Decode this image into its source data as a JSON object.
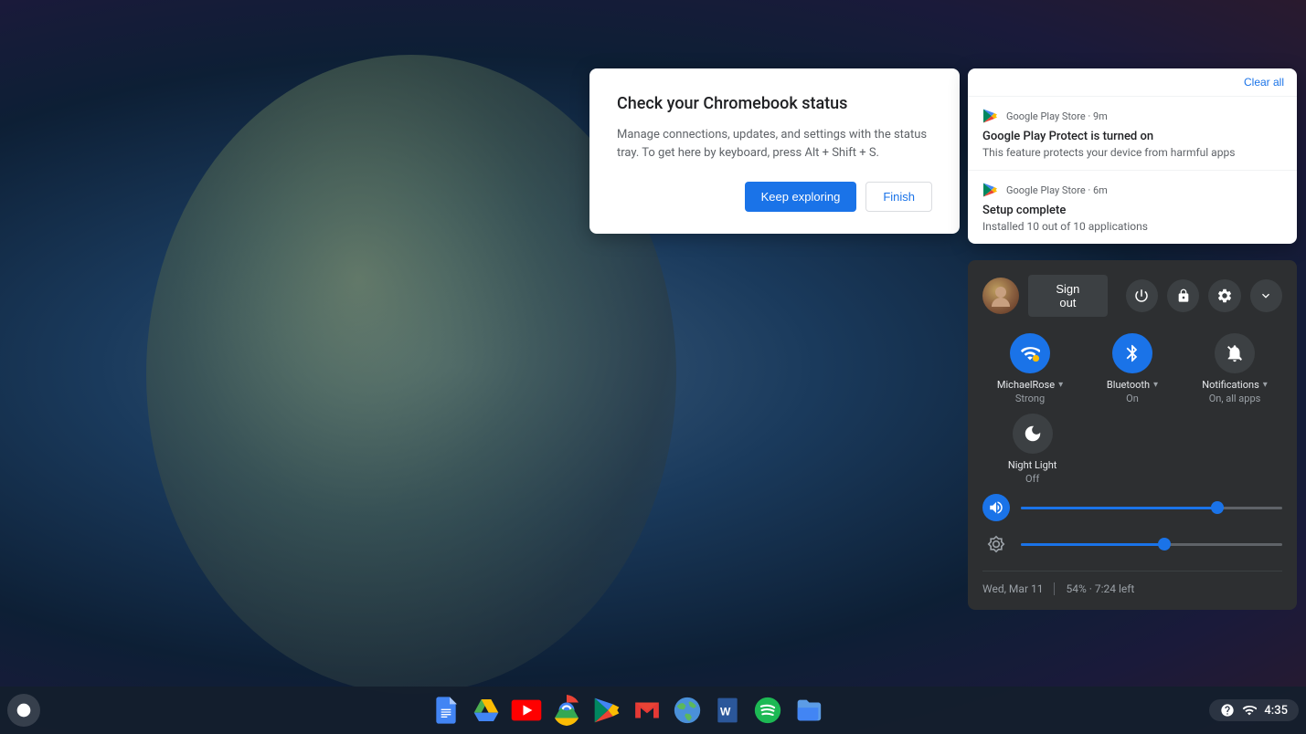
{
  "desktop": {
    "background": "dark blue gradient"
  },
  "status_dialog": {
    "title": "Check your Chromebook status",
    "body": "Manage connections, updates, and settings with the status tray. To get here by keyboard, press Alt + Shift + S.",
    "btn_keep_exploring": "Keep exploring",
    "btn_finish": "Finish"
  },
  "notification_panel": {
    "clear_all_label": "Clear all",
    "notifications": [
      {
        "source": "Google Play Store",
        "time": "9m",
        "title": "Google Play Protect is turned on",
        "body": "This feature protects your device from harmful apps"
      },
      {
        "source": "Google Play Store",
        "time": "6m",
        "title": "Setup complete",
        "body": "Installed 10 out of 10 applications"
      }
    ]
  },
  "quick_settings": {
    "user_avatar_alt": "User avatar",
    "sign_out_label": "Sign out",
    "power_icon": "⏻",
    "lock_icon": "🔒",
    "settings_icon": "⚙",
    "collapse_icon": "▾",
    "wifi": {
      "label": "MichaelRose",
      "sublabel": "Strong",
      "active": true
    },
    "bluetooth": {
      "label": "Bluetooth",
      "sublabel": "On",
      "active": true
    },
    "notifications": {
      "label": "Notifications",
      "sublabel": "On, all apps",
      "active": false
    },
    "night_light": {
      "label": "Night Light",
      "sublabel": "Off",
      "active": false
    },
    "volume_level": 75,
    "brightness_level": 55,
    "date": "Wed, Mar 11",
    "battery": "54% · 7:24 left"
  },
  "taskbar": {
    "time": "4:35",
    "apps": [
      {
        "name": "Google Docs",
        "color": "#4285f4"
      },
      {
        "name": "Google Drive",
        "color": "#fbbc04"
      },
      {
        "name": "YouTube",
        "color": "#ff0000"
      },
      {
        "name": "Chrome",
        "color": "#4285f4"
      },
      {
        "name": "Google Play",
        "color": "#01875f"
      },
      {
        "name": "Gmail",
        "color": "#ea4335"
      },
      {
        "name": "Chrome",
        "color": "#9c27b0"
      },
      {
        "name": "Word",
        "color": "#2b579a"
      },
      {
        "name": "Spotify",
        "color": "#1db954"
      },
      {
        "name": "Files",
        "color": "#4285f4"
      }
    ]
  }
}
